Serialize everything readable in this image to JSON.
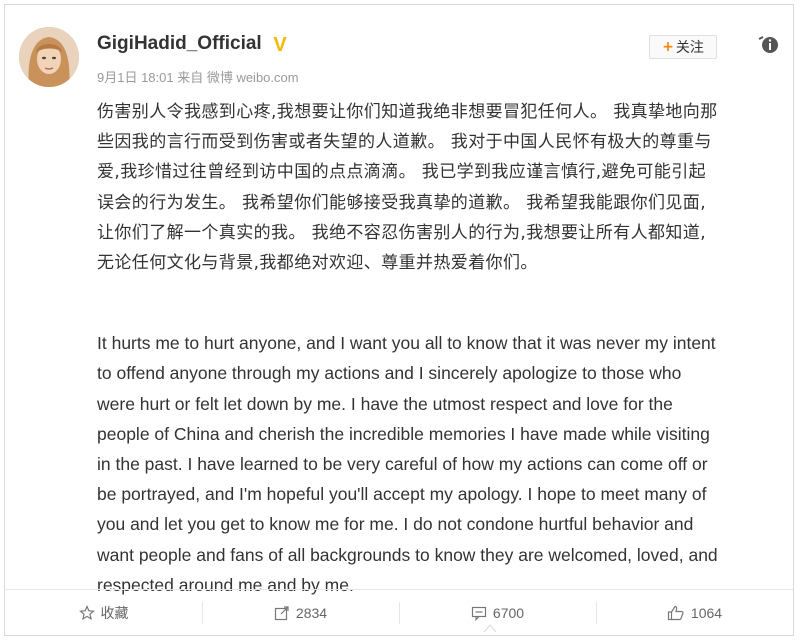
{
  "post": {
    "username": "GigiHadid_Official",
    "verified_badge": "V",
    "meta": "9月1日 18:01 来自 微博 weibo.com",
    "follow_label": "+关注",
    "follow_plus": "+",
    "follow_text": "关注",
    "content_cn": [
      "伤害别人令我感到心疼,我想要让你们知道我绝非想要冒犯任何人。 我真挚地向那",
      "些因我的言行而受到伤害或者失望的人道歉。 我对于中国人民怀有极大的尊重与",
      "爱,我珍惜过往曾经到访中国的点点滴滴。 我已学到我应谨言慎行,避免可能引起",
      "误会的行为发生。 我希望你们能够接受我真挚的道歉。 我希望我能跟你们见面,",
      "让你们了解一个真实的我。 我绝不容忍伤害别人的行为,我想要让所有人都知道,",
      "无论任何文化与背景,我都绝对欢迎、尊重并热爱着你们。"
    ],
    "content_en": [
      "It hurts me to hurt anyone, and I want you all to know that it was never my intent",
      "to offend anyone through my actions and I sincerely apologize to those who",
      "were hurt or felt let down by me. I have the utmost respect and love for the",
      "people of China and cherish the incredible memories I have made while visiting",
      "in the past. I have learned to be very careful of how my actions can come off or",
      "be portrayed, and I'm hopeful you'll accept my apology. I hope to meet many of",
      "you and let you get to know me for me. I do not condone hurtful behavior and",
      "want people and fans of all backgrounds to know they are welcomed, loved, and",
      "respected around me and by me."
    ]
  },
  "actions": {
    "favorite_label": "收藏",
    "repost_count": "2834",
    "comment_count": "6700",
    "like_count": "1064"
  },
  "colors": {
    "accent_orange": "#ff8200",
    "verified_yellow": "#f5b800",
    "text": "#333333",
    "meta_gray": "#9a9a9a"
  }
}
